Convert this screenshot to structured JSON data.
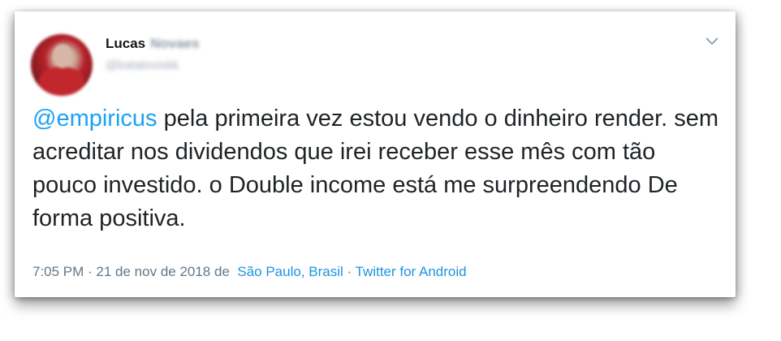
{
  "user": {
    "first_name": "Lucas",
    "last_name": "Novaes",
    "handle": "@batatoviskk"
  },
  "tweet": {
    "mention": "@empiricus",
    "body": " pela primeira vez estou vendo o dinheiro render. sem acreditar nos dividendos que irei receber esse mês com tão pouco investido. o Double income está me surpreendendo De forma positiva."
  },
  "meta": {
    "timestamp": "7:05 PM · 21 de nov de 2018 de",
    "location": "São Paulo, Brasil",
    "separator": "·",
    "source": "Twitter for Android"
  },
  "icons": {
    "menu": "chevron-down-icon"
  },
  "colors": {
    "link": "#1da1f2",
    "meta_link": "#1b95e0",
    "text": "#1f2326",
    "muted": "#657786",
    "caret": "#8899a6"
  }
}
